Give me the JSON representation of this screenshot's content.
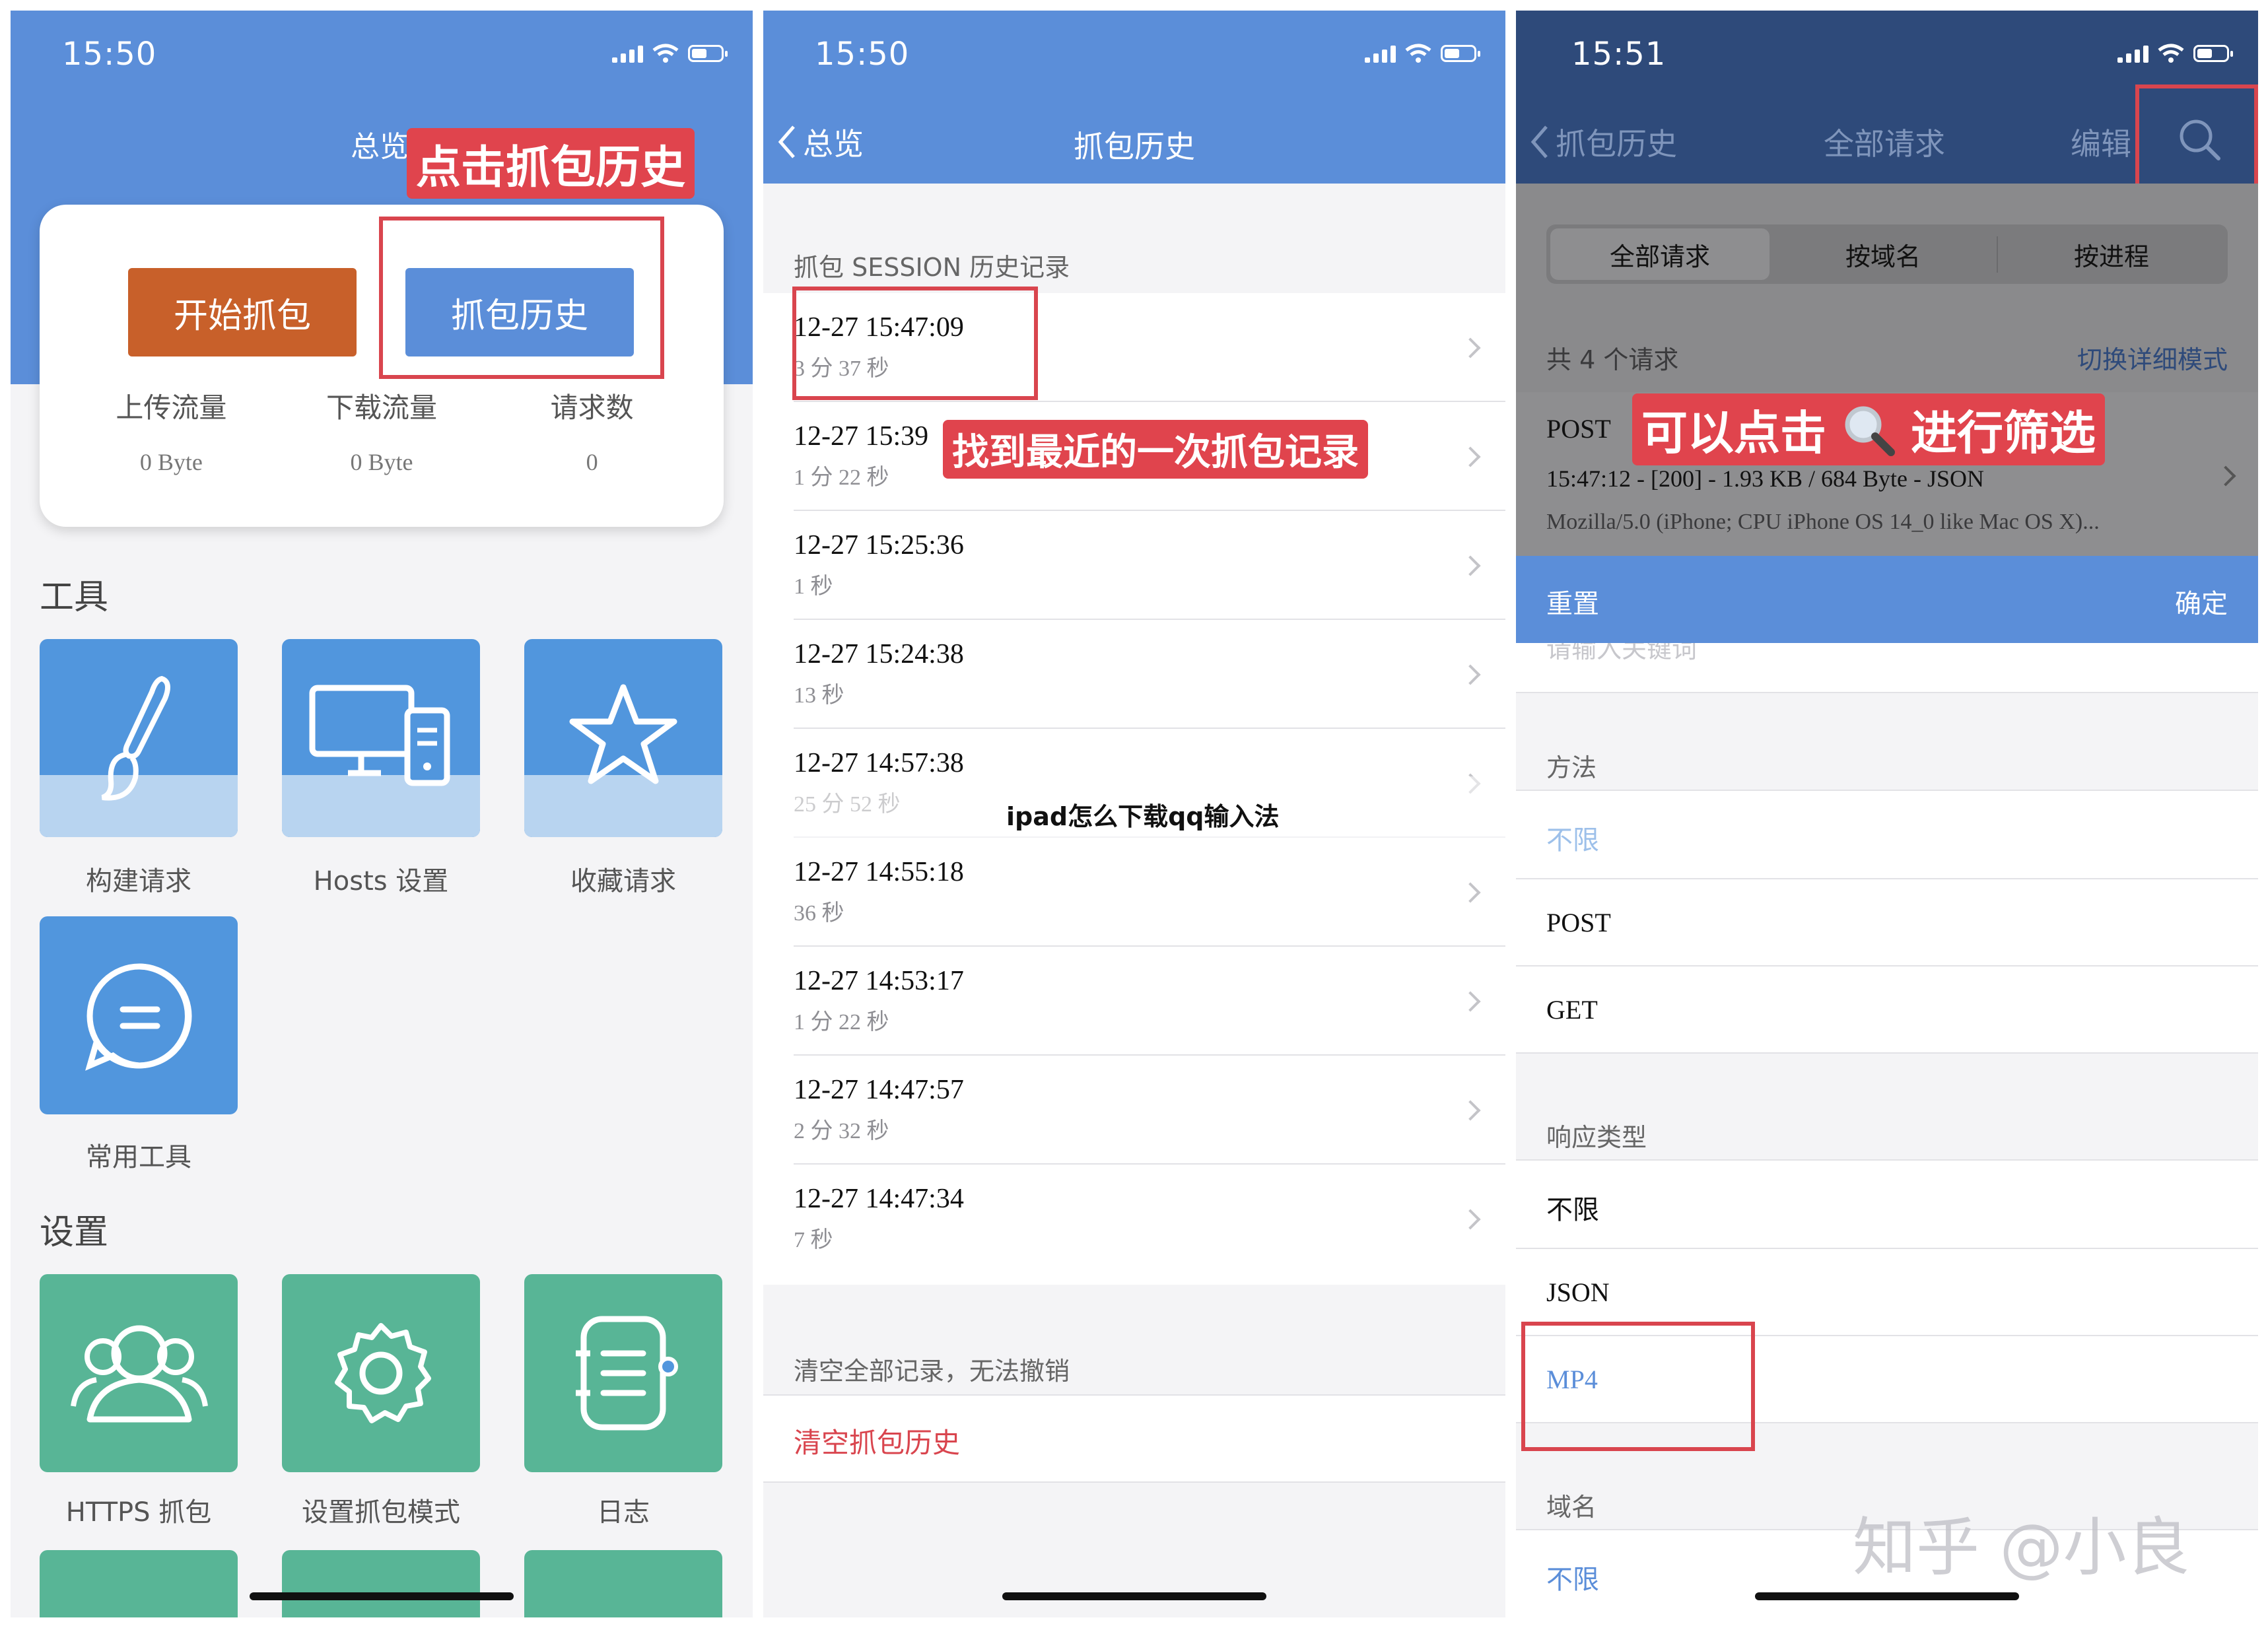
{
  "screens": {
    "overview": {
      "status_time": "15:50",
      "nav_title": "总览",
      "annotation": "点击抓包历史",
      "start_button": "开始抓包",
      "history_button": "抓包历史",
      "stats": [
        {
          "label": "上传流量",
          "value": "0 Byte"
        },
        {
          "label": "下载流量",
          "value": "0 Byte"
        },
        {
          "label": "请求数",
          "value": "0"
        }
      ],
      "tools_header": "工具",
      "tools": [
        "构建请求",
        "Hosts 设置",
        "收藏请求",
        "常用工具"
      ],
      "settings_header": "设置",
      "settings": [
        "HTTPS 抓包",
        "设置抓包模式",
        "日志"
      ]
    },
    "history": {
      "status_time": "15:50",
      "back_label": "总览",
      "title": "抓包历史",
      "section_header": "抓包 SESSION 历史记录",
      "annotation": "找到最近的一次抓包记录",
      "overlay_text": "ipad怎么下载qq输入法",
      "sessions": [
        {
          "time": "12-27 15:47:09",
          "duration": "3 分 37 秒"
        },
        {
          "time": "12-27 15:39",
          "duration": "1 分 22 秒"
        },
        {
          "time": "12-27 15:25:36",
          "duration": "1 秒"
        },
        {
          "time": "12-27 15:24:38",
          "duration": "13 秒"
        },
        {
          "time": "12-27 14:57:38",
          "duration": "25 分 52 秒"
        },
        {
          "time": "12-27 14:55:18",
          "duration": "36 秒"
        },
        {
          "time": "12-27 14:53:17",
          "duration": "1 分 22 秒"
        },
        {
          "time": "12-27 14:47:57",
          "duration": "2 分 32 秒"
        },
        {
          "time": "12-27 14:47:34",
          "duration": "7 秒"
        }
      ],
      "clear_note": "清空全部记录，无法撤销",
      "clear_button": "清空抓包历史"
    },
    "requests": {
      "status_time": "15:51",
      "back_label": "抓包历史",
      "title": "全部请求",
      "edit_label": "编辑",
      "segments": [
        "全部请求",
        "按域名",
        "按进程"
      ],
      "count_text": "共 4 个请求",
      "detail_mode": "切换详细模式",
      "request_method": "POST",
      "annotation_left": "可以点击",
      "annotation_right": "进行筛选",
      "request_meta": "15:47:12 - [200] - 1.93 KB / 684 Byte - JSON",
      "request_ua": "Mozilla/5.0 (iPhone; CPU iPhone OS 14_0 like Mac OS X)...",
      "reset_label": "重置",
      "confirm_label": "确定",
      "keyword_placeholder": "请输入关键词",
      "method_header": "方法",
      "methods": [
        "不限",
        "POST",
        "GET"
      ],
      "response_header": "响应类型",
      "responses": [
        "不限",
        "JSON",
        "MP4"
      ],
      "domain_header": "域名",
      "domain_value": "不限",
      "watermark": "知乎 @小良"
    }
  },
  "colors": {
    "nav_blue": "#5b8ed9",
    "nav_dark": "#2e4a7a",
    "orange": "#c8602a",
    "tool_blue": "#5196dd",
    "tool_green": "#58b596",
    "red": "#e0444d"
  }
}
